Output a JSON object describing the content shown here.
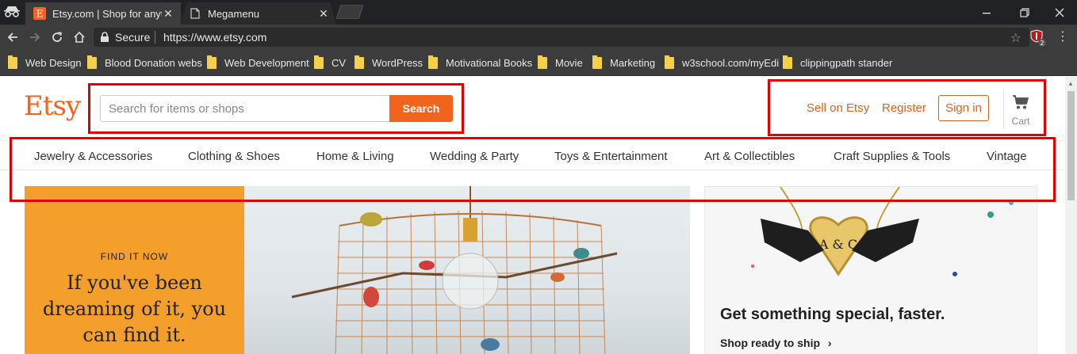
{
  "browser": {
    "tabs": [
      {
        "title": "Etsy.com | Shop for anyth",
        "favicon": "etsy-favicon",
        "active": true
      },
      {
        "title": "Megamenu",
        "favicon": "page-icon",
        "active": false
      }
    ],
    "tab_close": "✕",
    "secure_label": "Secure",
    "url": "https://www.etsy.com",
    "extension_badge": "2",
    "bookmarks": [
      "Web Design",
      "Blood Donation webs",
      "Web Development",
      "CV",
      "WordPress",
      "Motivational Books",
      "Movie",
      "Marketing",
      "w3school.com/myEdi",
      "clippingpath stander"
    ]
  },
  "header": {
    "logo": "Etsy",
    "search_placeholder": "Search for items or shops",
    "search_button": "Search",
    "sell_link": "Sell on Etsy",
    "register_link": "Register",
    "signin_button": "Sign in",
    "cart_label": "Cart"
  },
  "categories": [
    "Jewelry & Accessories",
    "Clothing & Shoes",
    "Home & Living",
    "Wedding & Party",
    "Toys & Entertainment",
    "Art & Collectibles",
    "Craft Supplies & Tools",
    "Vintage"
  ],
  "hero": {
    "kicker": "FIND IT NOW",
    "tagline": "If you've been dreaming of it, you can find it."
  },
  "side_promo": {
    "title": "Get something special, faster.",
    "link": "Shop ready to ship",
    "link_arrow": "›",
    "necklace_text": "A & C"
  },
  "colors": {
    "brand_orange": "#f1641e",
    "link_orange": "#d5641c",
    "promo_orange": "#f49f2b",
    "annotation_red": "#e30000"
  }
}
